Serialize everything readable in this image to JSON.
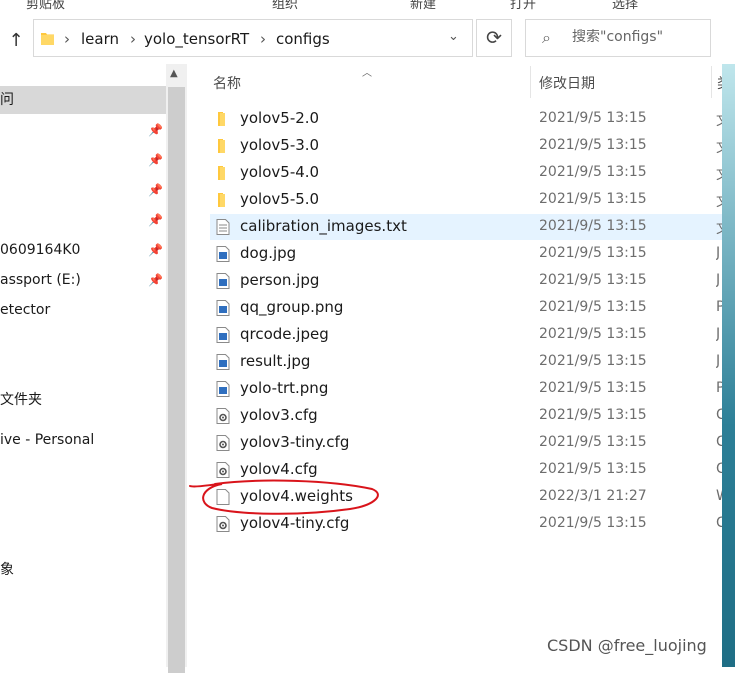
{
  "ribbon": {
    "items": [
      "剪贴板",
      "组织",
      "新建",
      "打开",
      "选择"
    ]
  },
  "address": {
    "crumbs": [
      "learn",
      "yolo_tensorRT",
      "configs"
    ]
  },
  "search": {
    "placeholder": "搜索\"configs\""
  },
  "sidebar": {
    "items": [
      {
        "label": "问",
        "pinned": false,
        "selected": true
      },
      {
        "label": "",
        "pinned": true
      },
      {
        "label": "",
        "pinned": true
      },
      {
        "label": "",
        "pinned": true
      },
      {
        "label": "",
        "pinned": true
      },
      {
        "label": "0609164K0",
        "pinned": true
      },
      {
        "label": "assport (E:)",
        "pinned": true
      },
      {
        "label": "etector",
        "pinned": false
      },
      {
        "label": "文件夹",
        "pinned": false
      },
      {
        "label": "ive - Personal",
        "pinned": false
      },
      {
        "label": "象",
        "pinned": false
      }
    ]
  },
  "columns": {
    "name": "名称",
    "date": "修改日期",
    "type": "类"
  },
  "files": [
    {
      "name": "yolov5-2.0",
      "date": "2021/9/5 13:15",
      "type": "文",
      "icon": "folder-icon"
    },
    {
      "name": "yolov5-3.0",
      "date": "2021/9/5 13:15",
      "type": "文",
      "icon": "folder-icon"
    },
    {
      "name": "yolov5-4.0",
      "date": "2021/9/5 13:15",
      "type": "文",
      "icon": "folder-icon"
    },
    {
      "name": "yolov5-5.0",
      "date": "2021/9/5 13:15",
      "type": "文",
      "icon": "folder-icon"
    },
    {
      "name": "calibration_images.txt",
      "date": "2021/9/5 13:15",
      "type": "文",
      "icon": "text-file-icon"
    },
    {
      "name": "dog.jpg",
      "date": "2021/9/5 13:15",
      "type": "J",
      "icon": "image-file-icon"
    },
    {
      "name": "person.jpg",
      "date": "2021/9/5 13:15",
      "type": "J",
      "icon": "image-file-icon"
    },
    {
      "name": "qq_group.png",
      "date": "2021/9/5 13:15",
      "type": "P",
      "icon": "image-file-icon"
    },
    {
      "name": "qrcode.jpeg",
      "date": "2021/9/5 13:15",
      "type": "J",
      "icon": "image-file-icon"
    },
    {
      "name": "result.jpg",
      "date": "2021/9/5 13:15",
      "type": "J",
      "icon": "image-file-icon"
    },
    {
      "name": "yolo-trt.png",
      "date": "2021/9/5 13:15",
      "type": "P",
      "icon": "image-file-icon"
    },
    {
      "name": "yolov3.cfg",
      "date": "2021/9/5 13:15",
      "type": "C",
      "icon": "config-file-icon"
    },
    {
      "name": "yolov3-tiny.cfg",
      "date": "2021/9/5 13:15",
      "type": "C",
      "icon": "config-file-icon"
    },
    {
      "name": "yolov4.cfg",
      "date": "2021/9/5 13:15",
      "type": "C",
      "icon": "config-file-icon"
    },
    {
      "name": "yolov4.weights",
      "date": "2022/3/1 21:27",
      "type": "W",
      "icon": "blank-file-icon"
    },
    {
      "name": "yolov4-tiny.cfg",
      "date": "2021/9/5 13:15",
      "type": "C",
      "icon": "config-file-icon"
    }
  ],
  "hovered_row": "calibration_images.txt",
  "circled_row": "yolov4.weights",
  "colors": {
    "hover": "#e5f3ff",
    "selected_nav": "#d8d8d8",
    "annotation": "#d9141b",
    "folder": "#ffd24d"
  },
  "watermark": "CSDN @free_luojing"
}
